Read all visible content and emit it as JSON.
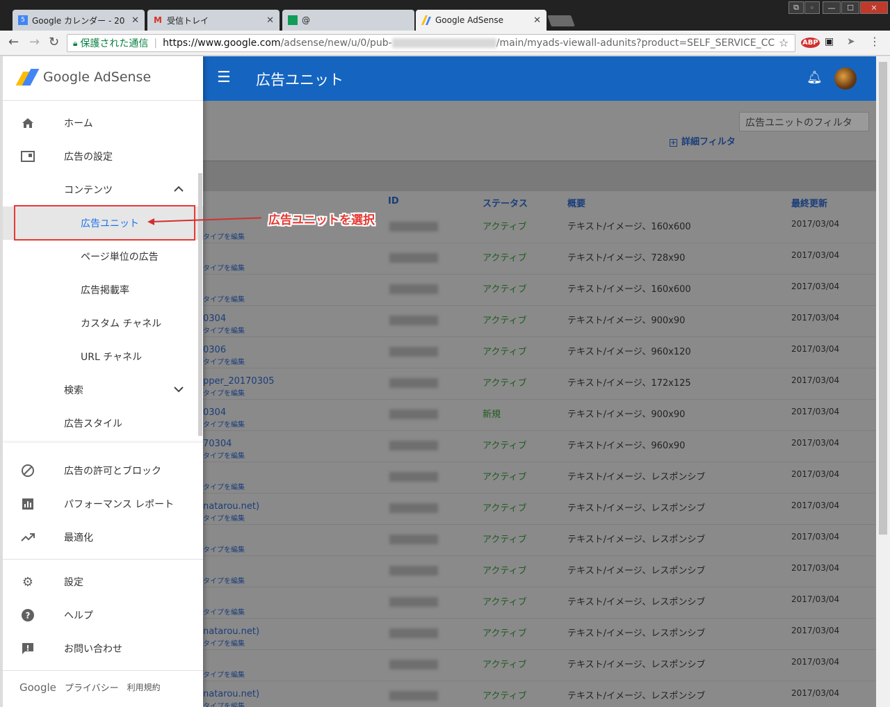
{
  "browser": {
    "tabs": [
      {
        "title": "Google カレンダー - 20",
        "favicon": "calendar-icon",
        "favicon_text": "5"
      },
      {
        "title": "受信トレイ",
        "favicon": "gmail-icon",
        "favicon_text": "M"
      },
      {
        "title": "@",
        "favicon": "sheets-icon",
        "favicon_text": ""
      },
      {
        "title": "Google AdSense",
        "favicon": "adsense-icon",
        "favicon_text": ""
      }
    ],
    "secure_label": "保護された通信",
    "url_host": "https://www.google.com",
    "url_path_1": "/adsense/new/u/0/pub-",
    "url_path_2": "/main/myads-viewall-adunits?product=SELF_SERVICE_CC",
    "ext_abp": "ABP"
  },
  "app": {
    "logo_text": "Google AdSense",
    "page_title": "広告ユニット"
  },
  "sidebar": {
    "items": [
      {
        "label": "ホーム",
        "icon": "home-icon"
      },
      {
        "label": "広告の設定",
        "icon": "ads-settings-icon"
      },
      {
        "label": "コンテンツ",
        "icon": ""
      },
      {
        "label": "広告ユニット",
        "icon": ""
      },
      {
        "label": "ページ単位の広告",
        "icon": ""
      },
      {
        "label": "広告掲載率",
        "icon": ""
      },
      {
        "label": "カスタム チャネル",
        "icon": ""
      },
      {
        "label": "URL チャネル",
        "icon": ""
      },
      {
        "label": "検索",
        "icon": ""
      },
      {
        "label": "広告スタイル",
        "icon": ""
      },
      {
        "label": "広告の許可とブロック",
        "icon": "block-icon"
      },
      {
        "label": "パフォーマンス レポート",
        "icon": "bar-chart-icon"
      },
      {
        "label": "最適化",
        "icon": "trending-icon"
      },
      {
        "label": "設定",
        "icon": "gear-icon"
      },
      {
        "label": "ヘルプ",
        "icon": "help-icon"
      },
      {
        "label": "お問い合わせ",
        "icon": "feedback-icon"
      }
    ],
    "footer": {
      "google": "Google",
      "privacy": "プライバシー",
      "terms": "利用規約"
    }
  },
  "content": {
    "filter_placeholder": "広告ユニットのフィルタ",
    "advanced_filter": "詳細フィルタ",
    "columns": {
      "id": "ID",
      "status": "ステータス",
      "summary": "概要",
      "updated": "最終更新"
    },
    "edit_label": "タイプを編集",
    "rows": [
      {
        "name": "",
        "status": "アクティブ",
        "summary": "テキスト/イメージ、160x600",
        "updated": "2017/03/04"
      },
      {
        "name": "",
        "status": "アクティブ",
        "summary": "テキスト/イメージ、728x90",
        "updated": "2017/03/04"
      },
      {
        "name": "",
        "status": "アクティブ",
        "summary": "テキスト/イメージ、160x600",
        "updated": "2017/03/04"
      },
      {
        "name": "0304",
        "status": "アクティブ",
        "summary": "テキスト/イメージ、900x90",
        "updated": "2017/03/04"
      },
      {
        "name": "0306",
        "status": "アクティブ",
        "summary": "テキスト/イメージ、960x120",
        "updated": "2017/03/04"
      },
      {
        "name": "pper_20170305",
        "status": "アクティブ",
        "summary": "テキスト/イメージ、172x125",
        "updated": "2017/03/04"
      },
      {
        "name": "0304",
        "status": "新規",
        "summary": "テキスト/イメージ、900x90",
        "updated": "2017/03/04"
      },
      {
        "name": "70304",
        "status": "アクティブ",
        "summary": "テキスト/イメージ、960x90",
        "updated": "2017/03/04"
      },
      {
        "name": "",
        "status": "アクティブ",
        "summary": "テキスト/イメージ、レスポンシブ",
        "updated": "2017/03/04"
      },
      {
        "name": "natarou.net)",
        "status": "アクティブ",
        "summary": "テキスト/イメージ、レスポンシブ",
        "updated": "2017/03/04"
      },
      {
        "name": "",
        "status": "アクティブ",
        "summary": "テキスト/イメージ、レスポンシブ",
        "updated": "2017/03/04"
      },
      {
        "name": "",
        "status": "アクティブ",
        "summary": "テキスト/イメージ、レスポンシブ",
        "updated": "2017/03/04"
      },
      {
        "name": "",
        "status": "アクティブ",
        "summary": "テキスト/イメージ、レスポンシブ",
        "updated": "2017/03/04"
      },
      {
        "name": "natarou.net)",
        "status": "アクティブ",
        "summary": "テキスト/イメージ、レスポンシブ",
        "updated": "2017/03/04"
      },
      {
        "name": "",
        "status": "アクティブ",
        "summary": "テキスト/イメージ、レスポンシブ",
        "updated": "2017/03/04"
      },
      {
        "name": "natarou.net)",
        "status": "アクティブ",
        "summary": "テキスト/イメージ、レスポンシブ",
        "updated": "2017/03/04"
      }
    ]
  },
  "annotation": {
    "callout_text": "広告ユニットを選択"
  },
  "colors": {
    "appbar": "#1565c0",
    "annotation": "#e53935",
    "selected_text": "#1a73e8"
  }
}
